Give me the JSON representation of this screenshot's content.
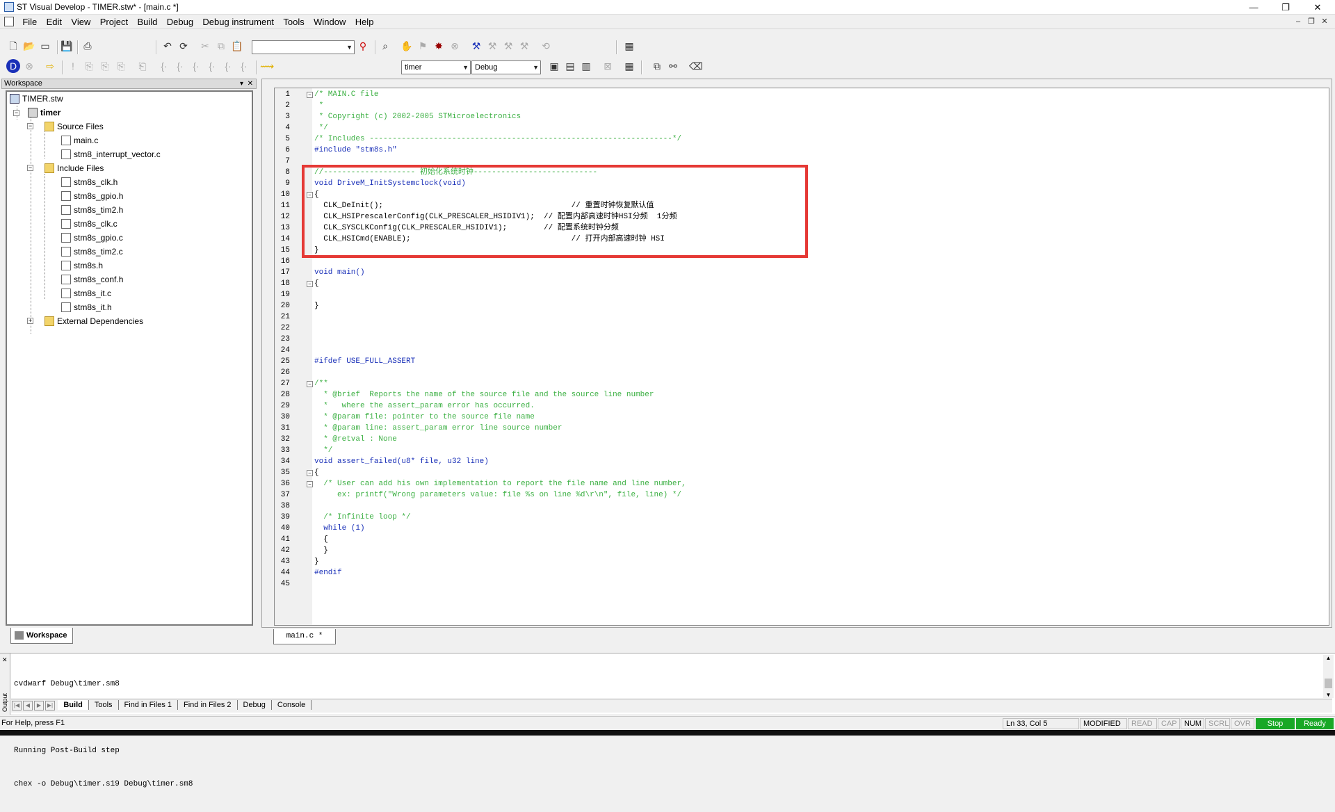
{
  "window": {
    "title": "ST Visual Develop - TIMER.stw* - [main.c *]",
    "controls": [
      "—",
      "❐",
      "✕"
    ]
  },
  "menu": [
    "File",
    "Edit",
    "View",
    "Project",
    "Build",
    "Debug",
    "Debug instrument",
    "Tools",
    "Window",
    "Help"
  ],
  "toolbar": {
    "search_combo_value": "",
    "project_combo_value": "timer",
    "config_combo_value": "Debug"
  },
  "workspace": {
    "header": "Workspace",
    "tab_label": "Workspace",
    "tree": {
      "root": "TIMER.stw",
      "project": "timer",
      "source_folder": "Source Files",
      "source_files": [
        "main.c",
        "stm8_interrupt_vector.c"
      ],
      "include_folder": "Include Files",
      "include_files": [
        "stm8s_clk.h",
        "stm8s_gpio.h",
        "stm8s_tim2.h",
        "stm8s_clk.c",
        "stm8s_gpio.c",
        "stm8s_tim2.c",
        "stm8s.h",
        "stm8s_conf.h",
        "stm8s_it.c",
        "stm8s_it.h"
      ],
      "external_folder": "External Dependencies"
    }
  },
  "editor": {
    "tab_label": "main.c *",
    "lines": [
      "/* MAIN.C file",
      " *",
      " * Copyright (c) 2002-2005 STMicroelectronics",
      " */",
      "/* Includes ------------------------------------------------------------------*/",
      "#include \"stm8s.h\"",
      "",
      "//-------------------- 初始化系统时钟---------------------------",
      "void DriveM_InitSystemclock(void)",
      "{",
      "  CLK_DeInit();                                         // 重置时钟恢复默认值",
      "  CLK_HSIPrescalerConfig(CLK_PRESCALER_HSIDIV1);  // 配置内部高速时钟HSI分频  1分频",
      "  CLK_SYSCLKConfig(CLK_PRESCALER_HSIDIV1);        // 配置系统时钟分频",
      "  CLK_HSICmd(ENABLE);                                   // 打开内部高速时钟 HSI",
      "}",
      "",
      "void main()",
      "{",
      "",
      "}",
      "",
      "",
      "",
      "",
      "#ifdef USE_FULL_ASSERT",
      "",
      "/**",
      "  * @brief  Reports the name of the source file and the source line number",
      "  *   where the assert_param error has occurred.",
      "  * @param file: pointer to the source file name",
      "  * @param line: assert_param error line source number",
      "  * @retval : None",
      "  */",
      "void assert_failed(u8* file, u32 line)",
      "{",
      "  /* User can add his own implementation to report the file name and line number,",
      "     ex: printf(\"Wrong parameters value: file %s on line %d\\r\\n\", file, line) */",
      "",
      "  /* Infinite loop */",
      "  while (1)",
      "  {",
      "  }",
      "}",
      "#endif",
      ""
    ]
  },
  "output": {
    "side_label": "Output",
    "lines": [
      "cvdwarf Debug\\timer.sm8",
      "",
      "Running Post-Build step",
      "chex -o Debug\\timer.s19 Debug\\timer.sm8"
    ],
    "tabs": [
      "Build",
      "Tools",
      "Find in Files 1",
      "Find in Files 2",
      "Debug",
      "Console"
    ]
  },
  "status": {
    "help": "For Help, press F1",
    "position": "Ln 33, Col 5",
    "modified": "MODIFIED",
    "read": "READ",
    "cap": "CAP",
    "num": "NUM",
    "scrl": "SCRL",
    "ovr": "OVR",
    "stop": "Stop",
    "ready": "Ready"
  },
  "colors": {
    "comment": "#3cb043",
    "keyword": "#1a30b8",
    "highlight_box": "#e53935",
    "status_green": "#18a826"
  }
}
